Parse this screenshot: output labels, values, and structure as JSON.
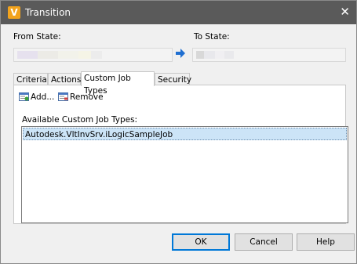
{
  "window": {
    "title": "Transition",
    "app_icon_letter": "V"
  },
  "from_state": {
    "label": "From State:"
  },
  "to_state": {
    "label": "To State:"
  },
  "tabs": [
    {
      "label": "Criteria"
    },
    {
      "label": "Actions"
    },
    {
      "label": "Custom Job Types",
      "active": true
    },
    {
      "label": "Security"
    }
  ],
  "toolbar": {
    "add_label": "Add...",
    "remove_label": "Remove"
  },
  "job_types": {
    "label": "Available Custom Job Types:",
    "items": [
      "Autodesk.VltInvSrv.iLogicSampleJob"
    ]
  },
  "buttons": {
    "ok": "OK",
    "cancel": "Cancel",
    "help": "Help"
  },
  "colors": {
    "titlebar": "#5a5a5a",
    "selection": "#cce4f7",
    "accent": "#0078d7",
    "arrow": "#1f6fd1"
  },
  "icons": [
    "vault-app-icon",
    "close-icon",
    "arrow-right-icon",
    "add-icon",
    "remove-icon"
  ]
}
